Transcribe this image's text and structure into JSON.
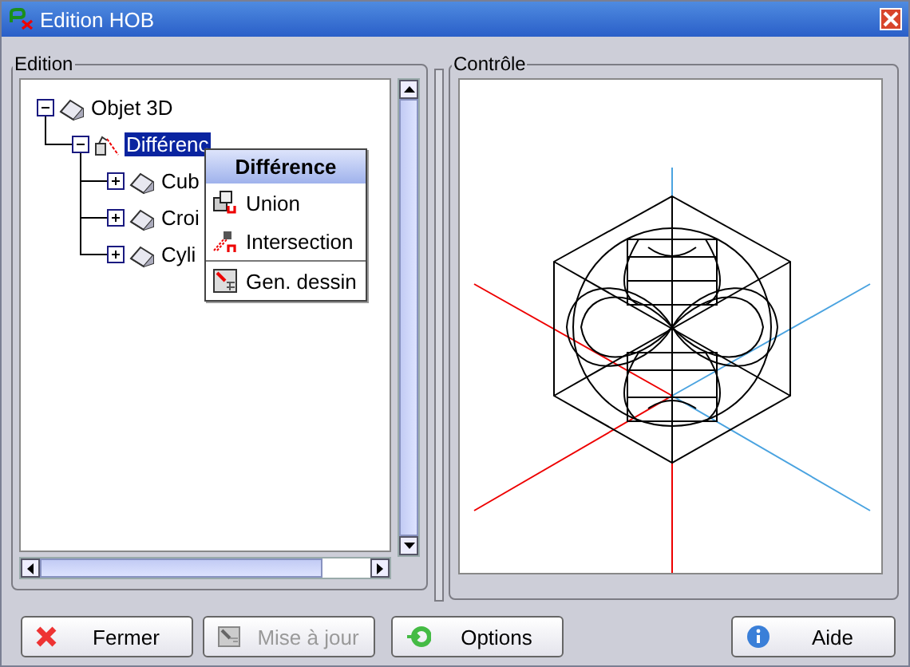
{
  "window": {
    "title": "Edition HOB"
  },
  "edition": {
    "legend": "Edition",
    "tree": [
      {
        "label": "Objet 3D",
        "kind": "object",
        "expanded": true,
        "selected": false,
        "children": [
          {
            "label": "Différenc",
            "kind": "operation",
            "expanded": true,
            "selected": true,
            "children": [
              {
                "label": "Cub",
                "kind": "object",
                "expanded": false,
                "selected": false
              },
              {
                "label": "Croi",
                "kind": "object",
                "expanded": false,
                "selected": false
              },
              {
                "label": "Cyli",
                "kind": "object",
                "expanded": false,
                "selected": false
              }
            ]
          }
        ]
      }
    ],
    "context_menu": {
      "title": "Différence",
      "items": [
        {
          "label": "Union",
          "kind": "union"
        },
        {
          "label": "Intersection",
          "kind": "intersection"
        },
        {
          "label": "Gen. dessin",
          "kind": "drawing",
          "separator_before": true
        }
      ]
    }
  },
  "controle": {
    "legend": "Contrôle"
  },
  "buttons": [
    {
      "label": "Fermer",
      "kind": "close",
      "disabled": false
    },
    {
      "label": "Mise à jour",
      "kind": "update",
      "disabled": true
    },
    {
      "label": "Options",
      "kind": "options",
      "disabled": false
    },
    {
      "label": "Aide",
      "kind": "help",
      "disabled": false
    }
  ]
}
